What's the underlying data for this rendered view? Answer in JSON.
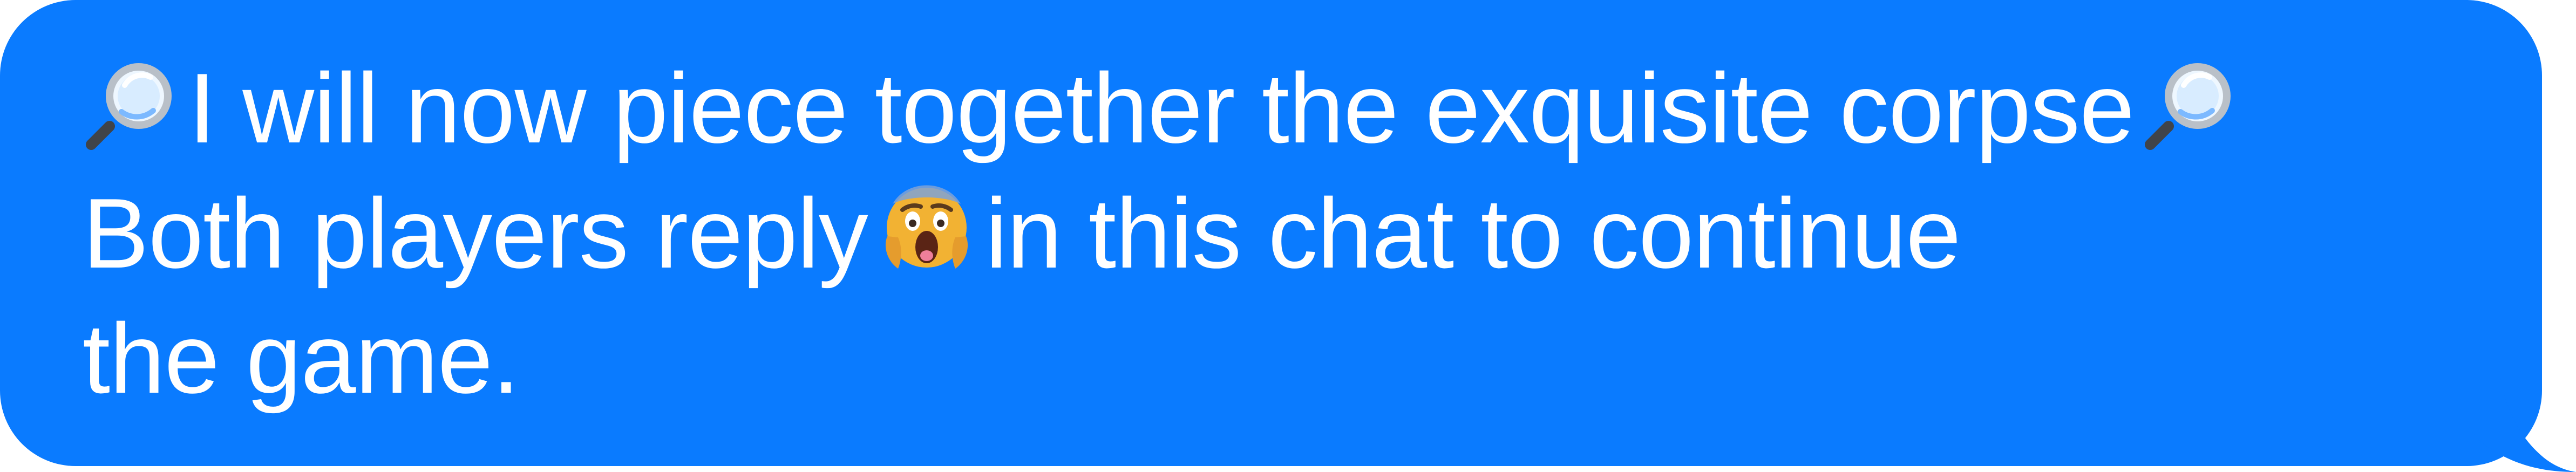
{
  "message": {
    "line1_text": "I will now piece together the exquisite corpse",
    "line2_before": "Both players reply",
    "line2_after": "in this chat to continue",
    "line3_text": "the game."
  },
  "icons": {
    "left_emoji": "magnifying-glass-left-icon",
    "right_emoji": "magnifying-glass-right-icon",
    "reaction_emoji": "face-screaming-in-fear-icon"
  },
  "colors": {
    "bubble": "#0a7bff",
    "text": "#ffffff"
  }
}
